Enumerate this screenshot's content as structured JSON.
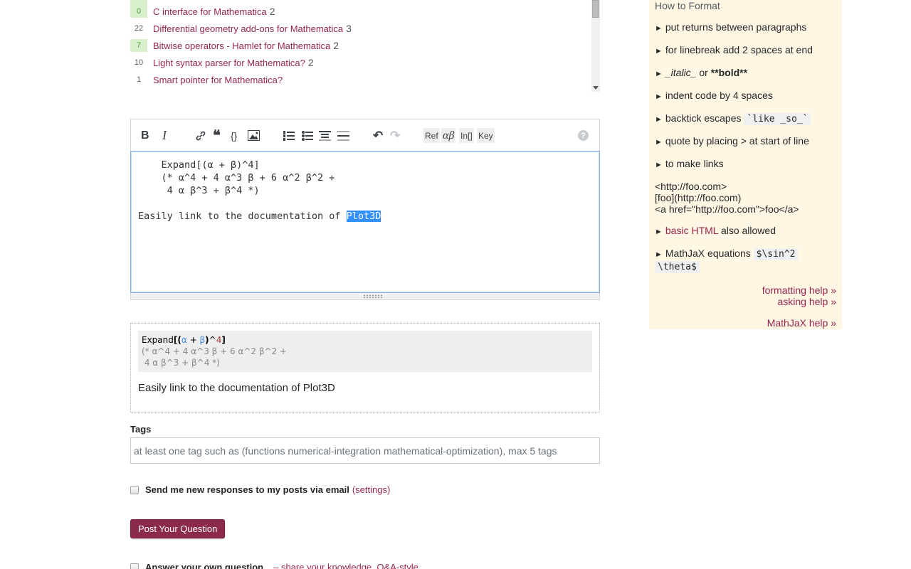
{
  "similar_questions": [
    {
      "score": "",
      "accepted": true,
      "title": "",
      "answers": ""
    },
    {
      "score": "0",
      "accepted": true,
      "title": "C interface for Mathematica",
      "answers": "2"
    },
    {
      "score": "22",
      "accepted": false,
      "title": "Differential geometry add-ons for Mathematica",
      "answers": "3"
    },
    {
      "score": "7",
      "accepted": true,
      "title": "Bitwise operators - Hamlet for Mathematica",
      "answers": "2"
    },
    {
      "score": "10",
      "accepted": false,
      "title": "Light syntax parser for Mathematica?",
      "answers": "2"
    },
    {
      "score": "1",
      "accepted": false,
      "title": "Smart pointer for Mathematica?",
      "answers": ""
    }
  ],
  "toolbar": {
    "buttons": [
      {
        "name": "bold-icon",
        "glyph": "B"
      },
      {
        "name": "italic-icon",
        "glyph": "I"
      },
      {
        "name": "link-icon",
        "glyph": "🔗"
      },
      {
        "name": "blockquote-icon",
        "glyph": "❝"
      },
      {
        "name": "code-icon",
        "glyph": "{}"
      },
      {
        "name": "image-icon",
        "glyph": "▣"
      },
      {
        "name": "numbered-list-icon",
        "glyph": "≡"
      },
      {
        "name": "bulleted-list-icon",
        "glyph": "≡"
      },
      {
        "name": "heading-icon",
        "glyph": "≡"
      },
      {
        "name": "horizontal-rule-icon",
        "glyph": "≡"
      },
      {
        "name": "undo-icon",
        "glyph": "↶"
      },
      {
        "name": "redo-icon",
        "glyph": "↷"
      }
    ],
    "ref_label": "Ref",
    "greek_label": "αβ",
    "in_label": "In[]",
    "key_label": "Key",
    "help_glyph": "?"
  },
  "editor": {
    "line1": "    Expand[(α + β)^4]",
    "line2": "    (* α^4 + 4 α^3 β + 6 α^2 β^2 +",
    "line3": "     4 α β^3 + β^4 *)",
    "line5_prefix": "Easily link to the documentation of ",
    "selected_text": "Plot3D"
  },
  "preview": {
    "code_kw": "Expand",
    "code_var_a": "α",
    "code_var_b": "β",
    "code_num": "4",
    "comment_line1": "(* α^4 + 4 α^3 β + 6 α^2 β^2 +",
    "comment_line2": " 4 α β^3 + β^4 *)",
    "text": "Easily link to the documentation of Plot3D"
  },
  "tags": {
    "label": "Tags",
    "placeholder": "at least one tag such as (functions numerical-integration mathematical-optimization), max 5 tags",
    "value": ""
  },
  "notify": {
    "label": "Send me new responses to my posts via email",
    "link": "(settings)",
    "checked": false
  },
  "post_button": "Post Your Question",
  "answer_own": {
    "label": "Answer your own question",
    "link": "– share your knowledge, Q&A-style"
  },
  "help": {
    "title": "How to Format",
    "items": [
      "put returns between paragraphs",
      "for linebreak add 2 spaces at end"
    ],
    "italic_text": "_italic_",
    "or_text": " or ",
    "bold_text": "**bold**",
    "indent_text": "indent code by 4 spaces",
    "backtick_text": "backtick escapes ",
    "backtick_code": "`like _so_`",
    "quote_text": "quote by placing > at start of line",
    "links_text": "to make links",
    "link_examples": [
      "<http://foo.com>",
      "[foo](http://foo.com)",
      "<a href=\"http://foo.com\">foo</a>"
    ],
    "html_link": "basic HTML",
    "html_rest": " also allowed",
    "mathjax_text": "MathJaX equations ",
    "mathjax_code1": "$\\sin^2 ",
    "mathjax_code2": "\\theta$",
    "formatting_help": "formatting help »",
    "asking_help": "asking help »",
    "mathjax_help": "MathJaX help »"
  },
  "colors": {
    "link": "#96254e",
    "button": "#8c2a4a",
    "sidebar_bg": "#fff6e4",
    "accepted_bg": "#d8f0cc",
    "selection": "#3390ff"
  }
}
